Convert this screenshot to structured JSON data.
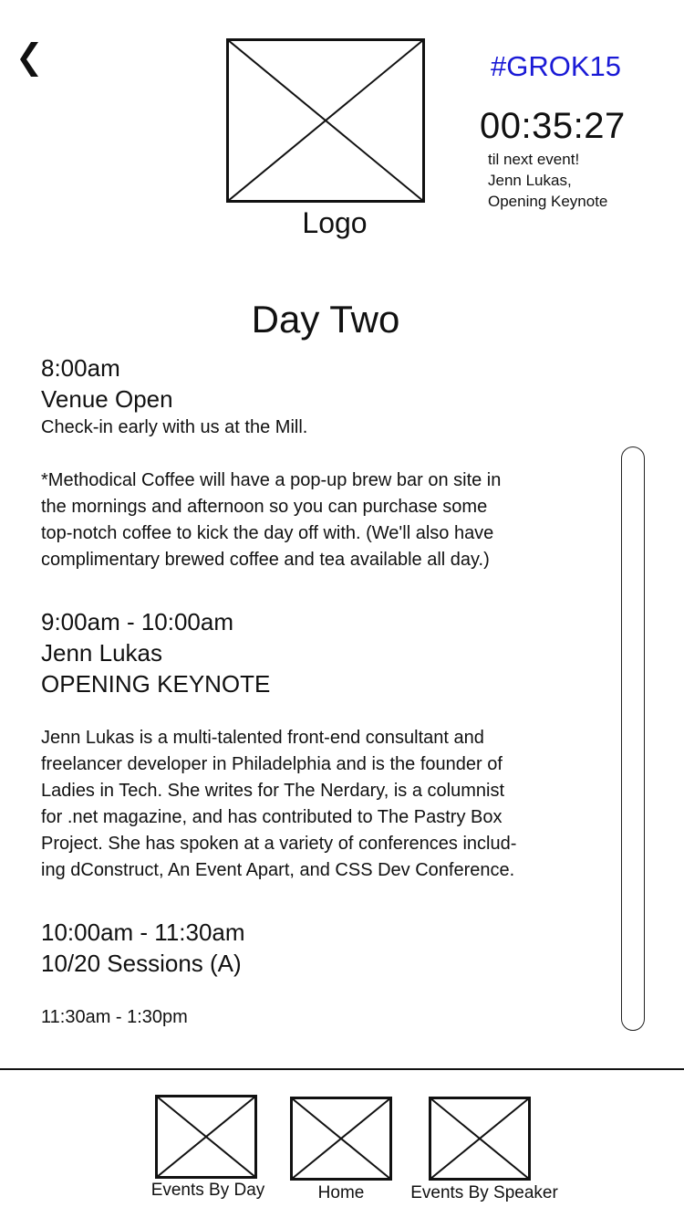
{
  "header": {
    "back_icon": "chevron-left-icon",
    "logo_label": "Logo",
    "hashtag": "#GROK15",
    "hashtag_color": "#1a1ad6",
    "countdown": "00:35:27",
    "countdown_sub": [
      "til next event!",
      "Jenn Lukas,",
      "Opening Keynote"
    ]
  },
  "day_title": "Day Two",
  "schedule": [
    {
      "time": "8:00am",
      "title": "Venue Open",
      "lines": [
        "Check-in early with us at the Mill.",
        "",
        "*Methodical Coffee will have a pop-up brew bar on site in",
        "the mornings and afternoon so you can purchase some",
        "top-notch coffee to kick the day off with. (We'll also have",
        "complimentary brewed coffee and tea available all day.)"
      ]
    },
    {
      "time": "9:00am - 10:00am",
      "title": "Jenn Lukas",
      "subtitle": "OPENING KEYNOTE",
      "lines": [
        "Jenn Lukas is a multi-talented front-end consultant and",
        "freelancer developer in Philadelphia and is the founder of",
        "Ladies in Tech. She writes for The Nerdary, is a columnist",
        "for .net magazine, and has contributed to The Pastry Box",
        "Project. She has spoken at a variety of conferences includ-",
        "ing dConstruct, An Event Apart, and CSS Dev Conference."
      ]
    },
    {
      "time": "10:00am - 11:30am",
      "title": "10/20 Sessions (A)"
    },
    {
      "time": "11:30am - 1:30pm"
    }
  ],
  "nav": {
    "items": [
      {
        "label": "Events By Day",
        "icon": "image-placeholder-icon"
      },
      {
        "label": "Home",
        "icon": "image-placeholder-icon"
      },
      {
        "label": "Events By Speaker",
        "icon": "image-placeholder-icon"
      }
    ]
  }
}
